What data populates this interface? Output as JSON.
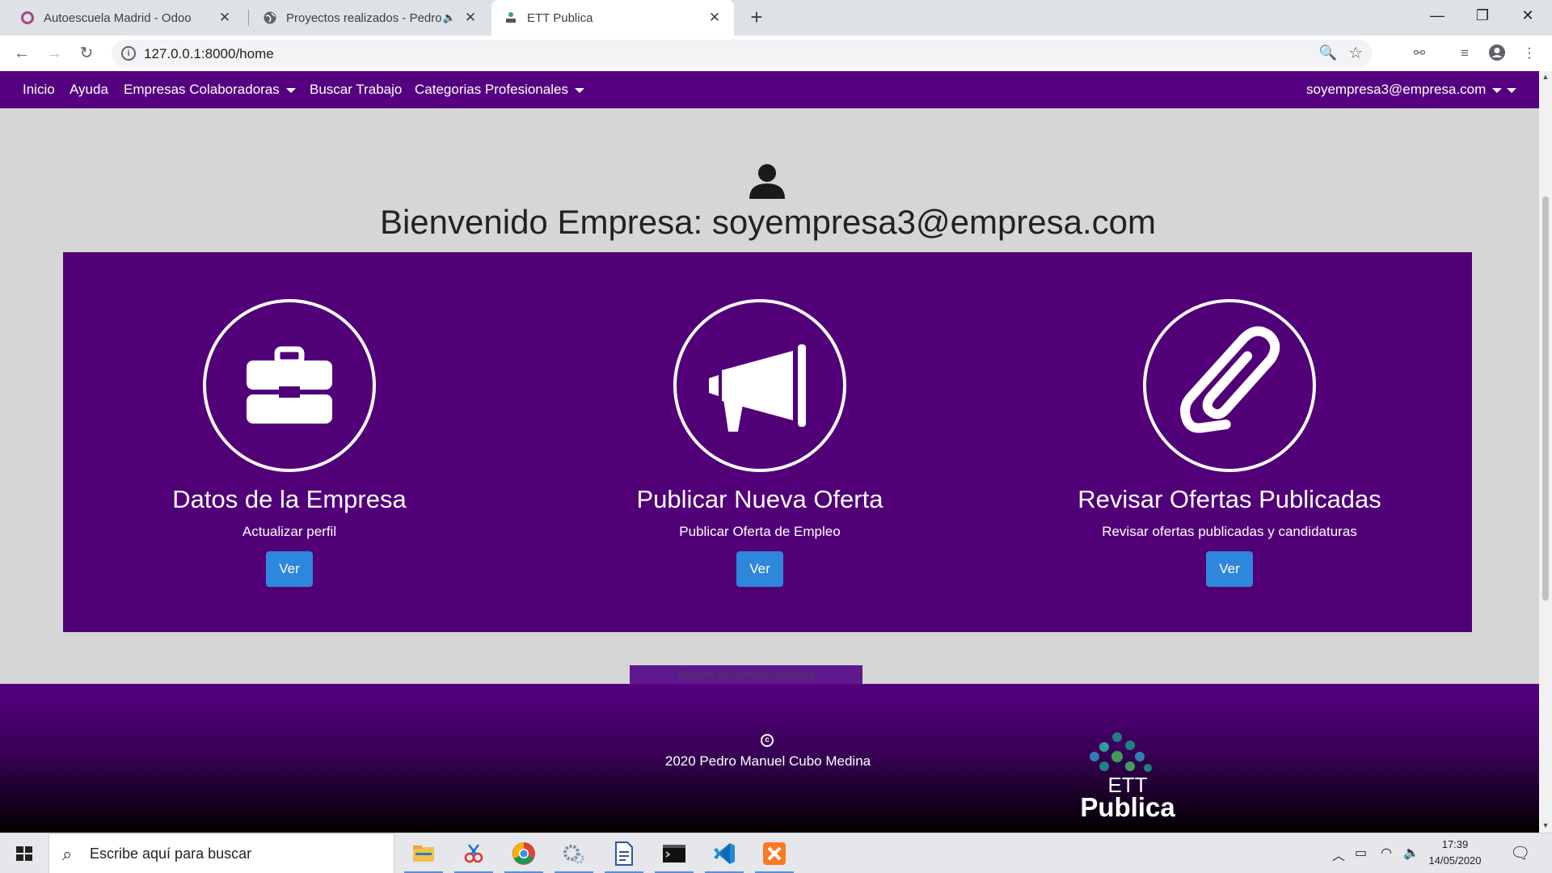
{
  "browser": {
    "tabs": [
      {
        "title": "Autoescuela Madrid - Odoo",
        "icon": "odoo-icon"
      },
      {
        "title": "Proyectos realizados - Pedro",
        "icon": "globe-icon",
        "audio": true
      },
      {
        "title": "ETT Publica",
        "icon": "ett-favicon",
        "active": true
      }
    ],
    "url": "127.0.0.1:8000/home"
  },
  "site": {
    "nav": {
      "inicio": "Inicio",
      "ayuda": "Ayuda",
      "empresas": "Empresas Colaboradoras",
      "buscar": "Buscar Trabajo",
      "categorias": "Categorias Profesionales",
      "user": "soyempresa3@empresa.com"
    },
    "welcome": "Bienvenido Empresa: soyempresa3@empresa.com",
    "cards": [
      {
        "title": "Datos de la Empresa",
        "subtitle": "Actualizar perfil",
        "button": "Ver",
        "icon": "briefcase-icon"
      },
      {
        "title": "Publicar Nueva Oferta",
        "subtitle": "Publicar Oferta de Empleo",
        "button": "Ver",
        "icon": "megaphone-icon"
      },
      {
        "title": "Revisar Ofertas Publicadas",
        "subtitle": "Revisar ofertas publicadas y candidaturas",
        "button": "Ver",
        "icon": "paperclip-icon"
      }
    ],
    "snip_tooltip": "Recorte de pantalla completa",
    "footer": {
      "copyright": "2020 Pedro Manuel Cubo Medina",
      "logo_line1": "ETT",
      "logo_line2": "Publica"
    },
    "colors": {
      "nav": "#550080",
      "panel": "#510078",
      "button": "#2f87dc"
    }
  },
  "taskbar": {
    "search_placeholder": "Escribe aquí para buscar",
    "time": "17:39",
    "date": "14/05/2020"
  }
}
